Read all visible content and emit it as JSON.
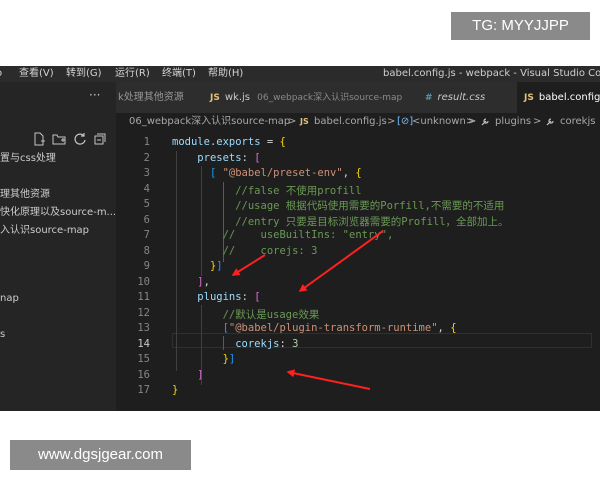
{
  "watermarks": {
    "top": "TG: MYYJJPP",
    "bottom": "www.dgsjgear.com"
  },
  "titlebar": {
    "menu": [
      "查看(V)",
      "转到(G)",
      "运行(R)",
      "终端(T)",
      "帮助(H)"
    ],
    "menu_partial": "o",
    "title": "babel.config.js - webpack - Visual Studio Code"
  },
  "sidebar": {
    "more": "···",
    "items": [
      "置与css处理",
      "理其他资源",
      "快化原理以及source-m...",
      "入认识source-map",
      "nap",
      "s"
    ]
  },
  "tabs": [
    {
      "label": "k处理其他资源",
      "icon": "",
      "desc": "",
      "active": false
    },
    {
      "label": "wk.js",
      "icon": "JS",
      "desc": "06_webpack深入认识source-map",
      "active": false
    },
    {
      "label": "result.css",
      "icon": "#",
      "desc": "",
      "active": false
    },
    {
      "label": "babel.config.js",
      "icon": "JS",
      "desc": "",
      "active": true
    }
  ],
  "breadcrumbs": [
    "06_webpack深入认识source-map",
    ">",
    "JS",
    "babel.config.js",
    ">",
    "[⊘]",
    "<unknown>",
    ">",
    "plugins",
    ">",
    "corekjs"
  ],
  "editor": {
    "line_numbers": [
      "1",
      "2",
      "3",
      "4",
      "5",
      "6",
      "7",
      "8",
      "9",
      "10",
      "11",
      "12",
      "13",
      "14",
      "15",
      "16",
      "17"
    ],
    "current_line": "14",
    "lines": [
      [
        [
          "module",
          "k"
        ],
        [
          ".",
          "w"
        ],
        [
          "exports",
          "k"
        ],
        [
          " = ",
          "w"
        ],
        [
          "{",
          "y"
        ]
      ],
      [
        [
          "    ",
          "w"
        ],
        [
          "presets",
          "k"
        ],
        [
          ": ",
          "w"
        ],
        [
          "[",
          "p"
        ]
      ],
      [
        [
          "      ",
          "w"
        ],
        [
          "[",
          "b"
        ],
        [
          " ",
          "w"
        ],
        [
          "\"@babel/preset-env\"",
          "s"
        ],
        [
          ", ",
          "w"
        ],
        [
          "{",
          "y"
        ]
      ],
      [
        [
          "          ",
          "w"
        ],
        [
          "//false 不使用profill",
          "c"
        ]
      ],
      [
        [
          "          ",
          "w"
        ],
        [
          "//usage 根据代码使用需要的Porfill,不需要的不适用",
          "c"
        ]
      ],
      [
        [
          "          ",
          "w"
        ],
        [
          "//entry 只要是目标浏览器需要的Profill，全部加上。",
          "c"
        ]
      ],
      [
        [
          "        ",
          "w"
        ],
        [
          "//    useBuiltIns: \"entry\",",
          "c"
        ]
      ],
      [
        [
          "        ",
          "w"
        ],
        [
          "//    corejs: 3",
          "c"
        ]
      ],
      [
        [
          "      ",
          "w"
        ],
        [
          "}",
          "y"
        ],
        [
          "]",
          "b"
        ]
      ],
      [
        [
          "    ",
          "w"
        ],
        [
          "]",
          "p"
        ],
        [
          ",",
          "w"
        ]
      ],
      [
        [
          "    ",
          "w"
        ],
        [
          "plugins",
          "k"
        ],
        [
          ": ",
          "w"
        ],
        [
          "[",
          "p"
        ]
      ],
      [
        [
          "        ",
          "w"
        ],
        [
          "//默认是usage效果",
          "c"
        ]
      ],
      [
        [
          "        ",
          "w"
        ],
        [
          "[",
          "b"
        ],
        [
          "\"@babel/plugin-transform-runtime\"",
          "s"
        ],
        [
          ", ",
          "w"
        ],
        [
          "{",
          "y"
        ]
      ],
      [
        [
          "          ",
          "w"
        ],
        [
          "corekjs",
          "k"
        ],
        [
          ": ",
          "w"
        ],
        [
          "3",
          "n"
        ]
      ],
      [
        [
          "        ",
          "w"
        ],
        [
          "}",
          "y"
        ],
        [
          "]",
          "b"
        ]
      ],
      [
        [
          "    ",
          "w"
        ],
        [
          "]",
          "p"
        ]
      ],
      [
        [
          "",
          "w"
        ],
        [
          "}",
          "y"
        ]
      ]
    ]
  },
  "colors": {
    "editor_bg": "#1e1e1e",
    "sidebar_bg": "#252526",
    "keyword": "#9cdcfe",
    "string": "#ce9178",
    "comment": "#6a9955",
    "number": "#b5cea8",
    "arrow": "#ff2020"
  }
}
